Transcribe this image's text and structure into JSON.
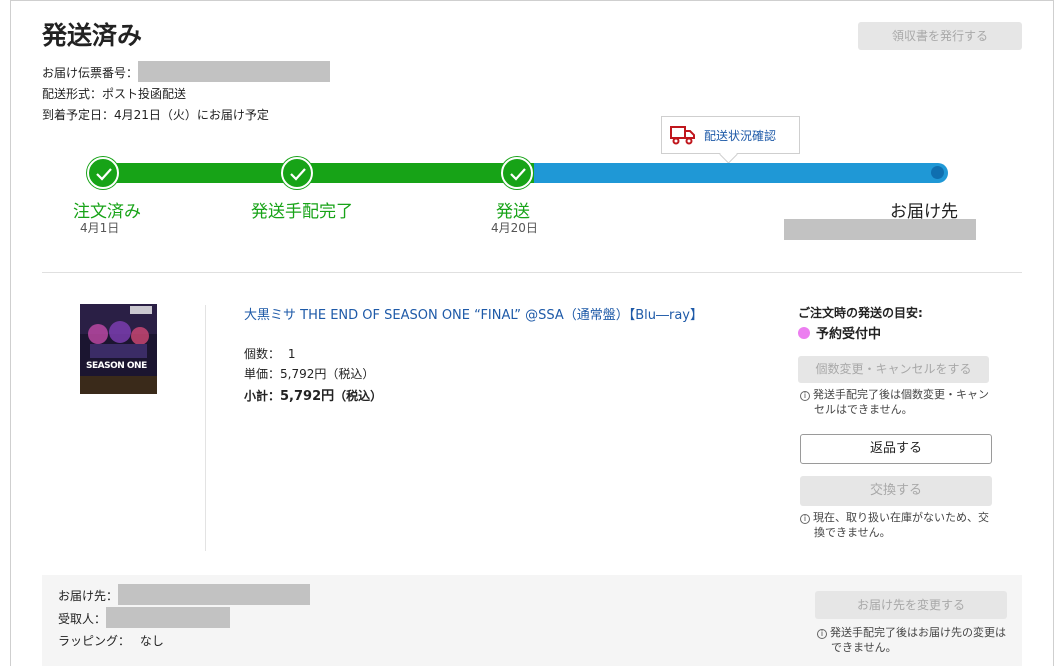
{
  "header": {
    "title": "発送済み",
    "receipt_button": "領収書を発行する",
    "tracking_label": "お届け伝票番号：",
    "shipping_method": "配送形式：ポスト投函配送",
    "arrival": "到着予定日：4月21日（火）にお届け予定"
  },
  "tracker": {
    "tooltip": "配送状況確認",
    "steps": [
      {
        "label": "注文済み",
        "date": "4月1日"
      },
      {
        "label": "発送手配完了",
        "date": ""
      },
      {
        "label": "発送",
        "date": "4月20日"
      },
      {
        "label": "お届け先",
        "date": ""
      }
    ]
  },
  "product": {
    "title": "大黒ミサ THE END OF SEASON ONE “FINAL” @SSA（通常盤）【Blu―ray】",
    "quantity_label": "個数：",
    "quantity": "1",
    "unit_label": "単価：",
    "unit_price": "5,792円（税込）",
    "subtotal_label": "小計：",
    "subtotal": "5,792円",
    "subtotal_tax": "（税込）",
    "cover_text": "SEASON ONE"
  },
  "actions": {
    "guide_title": "ご注文時の発送の目安:",
    "status": "予約受付中",
    "change_cancel_button": "個数変更・キャンセルをする",
    "change_note_1": "発送手配完了後は個数変更・キャン",
    "change_note_2": "セルはできません。",
    "return_button": "返品する",
    "exchange_button": "交換する",
    "exchange_note_1": "現在、取り扱い在庫がないため、交",
    "exchange_note_2": "換できません。"
  },
  "footer": {
    "address_label": "お届け先：",
    "recipient_label": "受取人：",
    "wrapping_label": "ラッピング：",
    "wrapping_value": "なし",
    "change_address_button": "お届け先を変更する",
    "address_note_1": "発送手配完了後はお届け先の変更は",
    "address_note_2": "できません。"
  },
  "colors": {
    "progress_done": "#17a317",
    "progress_pending": "#1f98d6",
    "link": "#1e5aa8",
    "status_dot": "#ec7ef0"
  }
}
